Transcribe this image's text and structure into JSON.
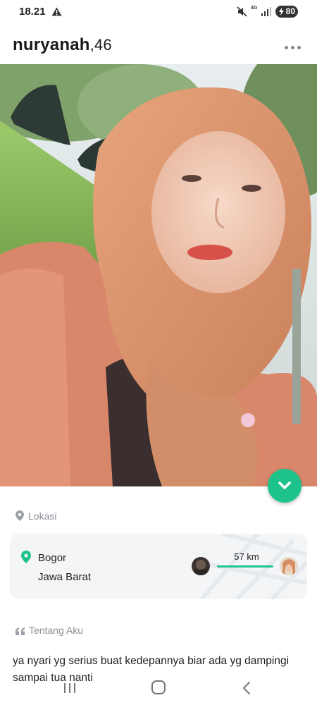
{
  "status_bar": {
    "time": "18.21",
    "network": "4G",
    "battery": "80",
    "icons": [
      "warning-icon",
      "mute-icon",
      "signal-icon",
      "battery-icon"
    ]
  },
  "header": {
    "name": "nuryanah",
    "age": ",46",
    "menu_icon": "more-dots-icon"
  },
  "location": {
    "section_label": "Lokasi",
    "city": "Bogor",
    "province": "Jawa Barat",
    "distance": "57 km"
  },
  "about": {
    "section_label": "Tentang Aku",
    "text": "ya nyari yg serius buat kedepannya biar ada yg dampingi sampai tua nanti"
  },
  "colors": {
    "accent": "#1ec38b",
    "label": "#8a8f96",
    "card": "#f3f5f7"
  }
}
